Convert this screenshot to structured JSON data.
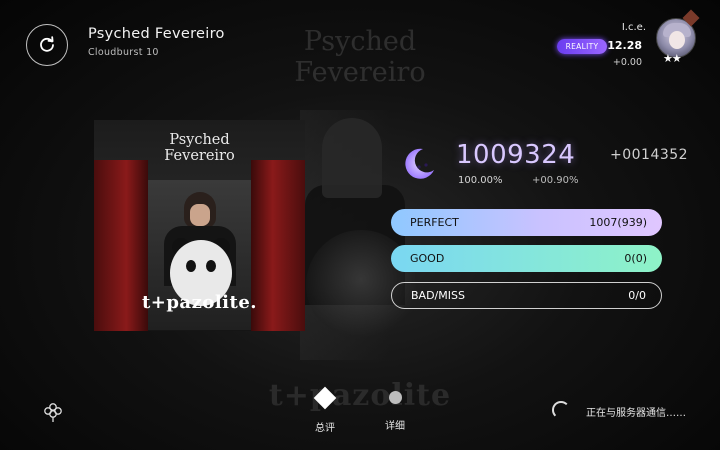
{
  "song": {
    "title": "Psyched Fevereiro",
    "level": "Cloudburst 10"
  },
  "background": {
    "title": "Psyched Fevereiro",
    "logo": "t+pazolite"
  },
  "cover": {
    "title": "Psyched\nFevereiro",
    "logo": "t+pazolite."
  },
  "player": {
    "name": "I.c.e.",
    "reality_label": "REALITY",
    "reality_value": "12.28",
    "reality_delta": "+0.00",
    "stars": "★★"
  },
  "result": {
    "score": "1009324",
    "score_delta": "+0014352",
    "accuracy": "100.00%",
    "accuracy_delta": "+00.90%"
  },
  "judgements": [
    {
      "label": "PERFECT",
      "value": "1007(939)"
    },
    {
      "label": "GOOD",
      "value": "0(0)"
    },
    {
      "label": "BAD/MISS",
      "value": "0/0"
    }
  ],
  "tabs": {
    "summary": "总评",
    "detail": "详细"
  },
  "status": {
    "server": "正在与服务器通信……"
  },
  "colors": {
    "score": "#d9c8ff",
    "reality_badge": "#7a4dff",
    "perfect_bar": "#c9c2ff",
    "good_bar": "#8ef3c7"
  },
  "icons": {
    "retry": "retry-icon",
    "moon": "crescent-moon-icon",
    "flower": "flower-icon",
    "summary": "diamond-icon",
    "detail": "dot-icon"
  }
}
